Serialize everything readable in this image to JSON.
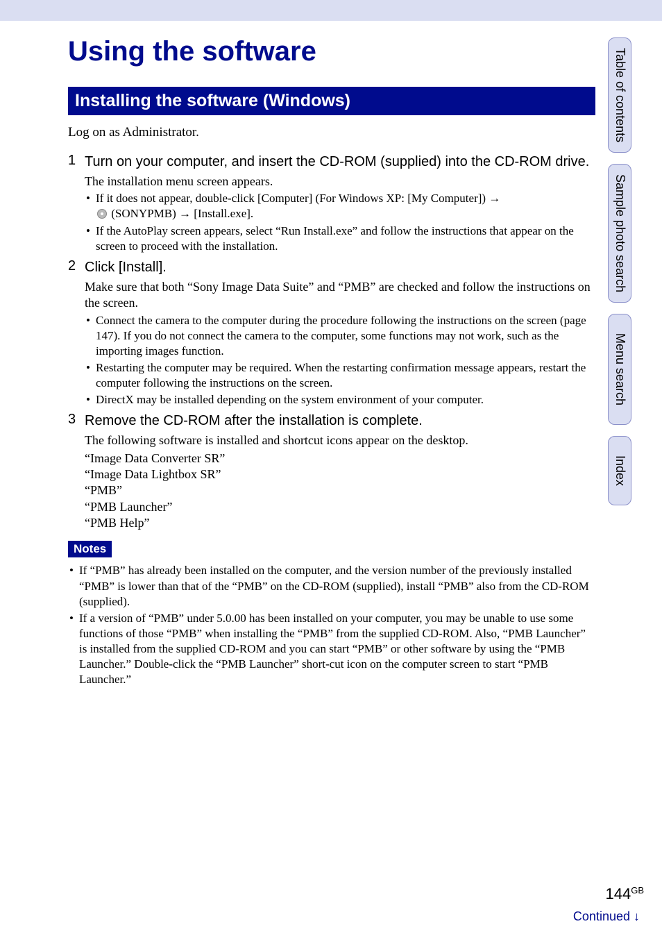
{
  "title": "Using the software",
  "section_heading": "Installing the software (Windows)",
  "intro": "Log on as Administrator.",
  "steps": [
    {
      "num": "1",
      "head": "Turn on your computer, and insert the CD-ROM (supplied) into the CD-ROM drive.",
      "desc": "The installation menu screen appears.",
      "bullets": [
        {
          "prefix": "If it does not appear, double-click [Computer] (For Windows XP: [My Computer]) ",
          "arrow1": "→",
          "mid": " (SONYPMB) ",
          "arrow2": "→",
          "suffix": " [Install.exe].",
          "has_disc_icon": true
        },
        {
          "text": "If the AutoPlay screen appears, select “Run Install.exe” and follow the instructions that appear on the screen to proceed with the installation."
        }
      ]
    },
    {
      "num": "2",
      "head": "Click [Install].",
      "desc": "Make sure that both “Sony Image Data Suite” and “PMB” are checked and follow the instructions on the screen.",
      "bullets": [
        {
          "text": "Connect the camera to the computer during the procedure following the instructions on the screen (page 147). If you do not connect the camera to the computer, some functions may not work, such as the importing images function."
        },
        {
          "text": "Restarting the computer may be required. When the restarting confirmation message appears, restart the computer following the instructions on the screen."
        },
        {
          "text": "DirectX may be installed depending on the system environment of your computer."
        }
      ]
    },
    {
      "num": "3",
      "head": "Remove the CD-ROM after the installation is complete.",
      "desc": "The following software is installed and shortcut icons appear on the desktop.",
      "software": [
        "“Image Data Converter SR”",
        "“Image Data Lightbox SR”",
        "“PMB”",
        "“PMB Launcher”",
        "“PMB Help”"
      ]
    }
  ],
  "notes_label": "Notes",
  "notes": [
    "If “PMB” has already been installed on the computer, and the version number of the previously installed “PMB” is lower than that of the “PMB” on the CD-ROM (supplied), install “PMB” also from the CD-ROM (supplied).",
    "If a version of “PMB” under 5.0.00 has been installed on your computer, you may be unable to use some functions of those “PMB” when installing the “PMB” from the supplied CD-ROM. Also, “PMB Launcher” is installed from the supplied CD-ROM and you can start “PMB” or other software by using the “PMB Launcher.” Double-click the “PMB Launcher” short-cut icon on the computer screen to start “PMB Launcher.”"
  ],
  "tabs": [
    "Table of contents",
    "Sample photo search",
    "Menu search",
    "Index"
  ],
  "page_number": "144",
  "page_suffix": "GB",
  "continued": "Continued ",
  "continued_arrow": "↓"
}
